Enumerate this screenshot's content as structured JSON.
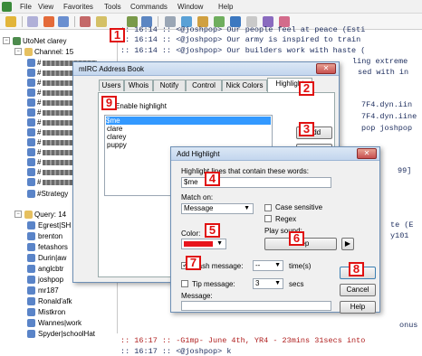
{
  "menu": [
    "File",
    "View",
    "Favorites",
    "Tools",
    "Commands",
    "Window",
    "Help"
  ],
  "tree": {
    "network": "UtoNet clarey",
    "channels_label": "Channel: 15",
    "channel_items": [
      "#",
      "#",
      "#",
      "#",
      "#",
      "#",
      "#",
      "#",
      "#",
      "#",
      "#",
      "#",
      "#",
      "#Strategy"
    ],
    "query_label": "Query: 14",
    "query_items": [
      "Egrest|SH",
      "brenton",
      "fetashors",
      "Durin|aw",
      "anglcbtr",
      "joshpop",
      "mr187",
      "Ronald'afk",
      "Mistkron",
      "Wannes|work",
      "Spyder|schoolHat"
    ]
  },
  "chat_lines": [
    ":: 16:14 :: <@joshpop> Our people feel at peace (Esti",
    ":: 16:14 :: <@joshpop> Our army is inspired to train",
    ":: 16:14 :: <@joshpop> Our builders work with haste (",
    "ling extreme",
    "sed with in",
    "7F4.dyn.iin",
    "7F4.dyn.iine",
    "pop joshpop",
    "99]",
    "te (E",
    "y101",
    "onus",
    ":: 16:17 :: -G1mp- June 4th, YR4 - 23mins 31secs into",
    ":: 16:17 :: <@joshpop> k"
  ],
  "address_book": {
    "title": "mIRC Address Book",
    "tabs": [
      "Users",
      "Whois",
      "Notify",
      "Control",
      "Nick Colors",
      "Highlight"
    ],
    "enable_highlight": "Enable highlight",
    "list": [
      "$me",
      "clare",
      "clarey",
      "puppy"
    ],
    "add_button": "Add"
  },
  "add_highlight": {
    "title": "Add Highlight",
    "prompt": "Highlight lines that contain these words:",
    "words_value": "$me",
    "match_on_label": "Match on:",
    "match_on_value": "Message",
    "case_sensitive": "Case sensitive",
    "regex": "Regex",
    "color_label": "Color:",
    "play_sound_label": "Play sound:",
    "sound_value": "Beep",
    "color_value": "#e8141c",
    "flash_message": "Flash message:",
    "flash_value": "--",
    "flash_unit": "time(s)",
    "tip_message": "Tip message:",
    "tip_value": "3",
    "tip_unit": "secs",
    "message_label": "Message:",
    "ok_button": "OK",
    "cancel_button": "Cancel",
    "help_button": "Help"
  },
  "badges": [
    "1",
    "2",
    "3",
    "4",
    "5",
    "6",
    "7",
    "8",
    "9"
  ]
}
